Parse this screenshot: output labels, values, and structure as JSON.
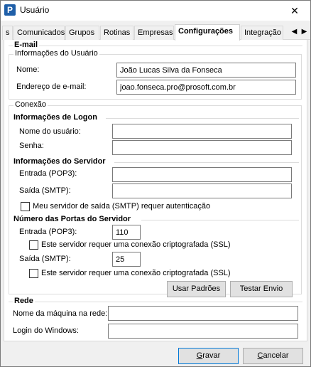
{
  "window": {
    "title": "Usuário",
    "icon_letter": "P"
  },
  "tabs": [
    {
      "label": "s"
    },
    {
      "label": "Comunicados"
    },
    {
      "label": "Grupos"
    },
    {
      "label": "Rotinas"
    },
    {
      "label": "Empresas"
    },
    {
      "label": "Configurações"
    },
    {
      "label": "Integração"
    }
  ],
  "tab_arrows": {
    "left": "◀",
    "right": "▶"
  },
  "email": {
    "legend": "E-mail",
    "user_info": {
      "legend": "Informações do Usuário",
      "name_label": "Nome:",
      "name_value": "João Lucas Silva da Fonseca",
      "email_label": "Endereço de e-mail:",
      "email_value": "joao.fonseca.pro@prosoft.com.br"
    },
    "connection": {
      "legend": "Conexão",
      "logon": {
        "heading": "Informações de Logon",
        "user_label": "Nome do usuário:",
        "user_value": "",
        "password_label": "Senha:",
        "password_value": ""
      },
      "server": {
        "heading": "Informações do Servidor",
        "incoming_label": "Entrada (POP3):",
        "incoming_value": "",
        "outgoing_label": "Saída (SMTP):",
        "outgoing_value": "",
        "auth_label": "Meu servidor de saída (SMTP) requer autenticação"
      },
      "ports": {
        "heading": "Número das Portas do Servidor",
        "incoming_label": "Entrada (POP3):",
        "incoming_value": "110",
        "incoming_ssl_label": "Este servidor requer uma conexão criptografada (SSL)",
        "outgoing_label": "Saída (SMTP):",
        "outgoing_value": "25",
        "outgoing_ssl_label": "Este servidor requer uma conexão criptografada (SSL)"
      },
      "defaults_button": "Usar Padrões",
      "test_button": "Testar Envio"
    }
  },
  "network": {
    "legend": "Rede",
    "machine_label": "Nome da máquina na rede:",
    "machine_value": "",
    "windows_login_label": "Login do Windows:",
    "windows_login_value": ""
  },
  "footer": {
    "save_button": "Gravar",
    "cancel_button": "Cancelar"
  }
}
